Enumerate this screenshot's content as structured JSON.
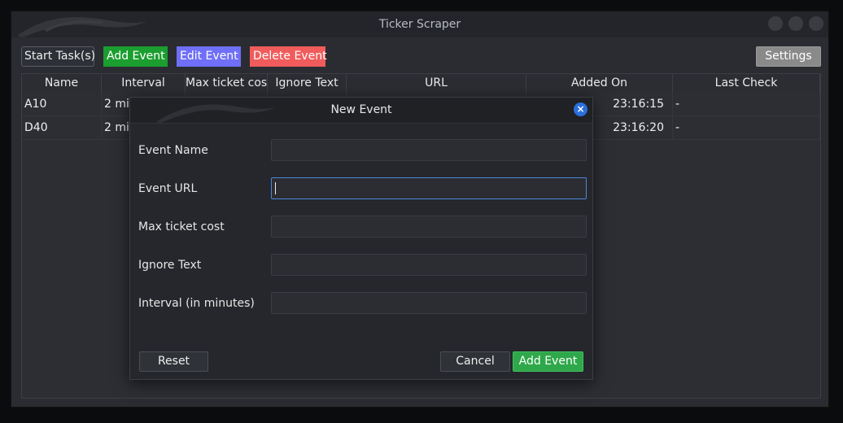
{
  "window": {
    "title": "Ticker Scraper"
  },
  "toolbar": {
    "start_label": "Start Task(s)",
    "add_label": "Add Event",
    "edit_label": "Edit Event",
    "delete_label": "Delete Event",
    "settings_label": "Settings"
  },
  "table": {
    "headers": [
      "Name",
      "Interval",
      "Max ticket cost",
      "Ignore Text",
      "URL",
      "Added On",
      "Last Check"
    ],
    "rows": [
      {
        "name": "A10",
        "interval": "2 mi",
        "added_on": "23:16:15",
        "last_check": "-"
      },
      {
        "name": "D40",
        "interval": "2 mi",
        "added_on": "23:16:20",
        "last_check": "-"
      }
    ]
  },
  "dialog": {
    "title": "New Event",
    "fields": [
      {
        "label": "Event Name",
        "value": ""
      },
      {
        "label": "Event URL",
        "value": ""
      },
      {
        "label": "Max ticket cost",
        "value": ""
      },
      {
        "label": "Ignore Text",
        "value": ""
      },
      {
        "label": "Interval (in minutes)",
        "value": ""
      }
    ],
    "reset_label": "Reset",
    "cancel_label": "Cancel",
    "add_label": "Add Event"
  },
  "colors": {
    "add": "#1b9e2f",
    "edit": "#6f6ff7",
    "delete": "#f05c5c",
    "settings": "#8a8a8a",
    "close_icon": "#2a6fdb"
  },
  "icons": {
    "close": "close-icon",
    "logo": "dragon-logo-icon"
  }
}
